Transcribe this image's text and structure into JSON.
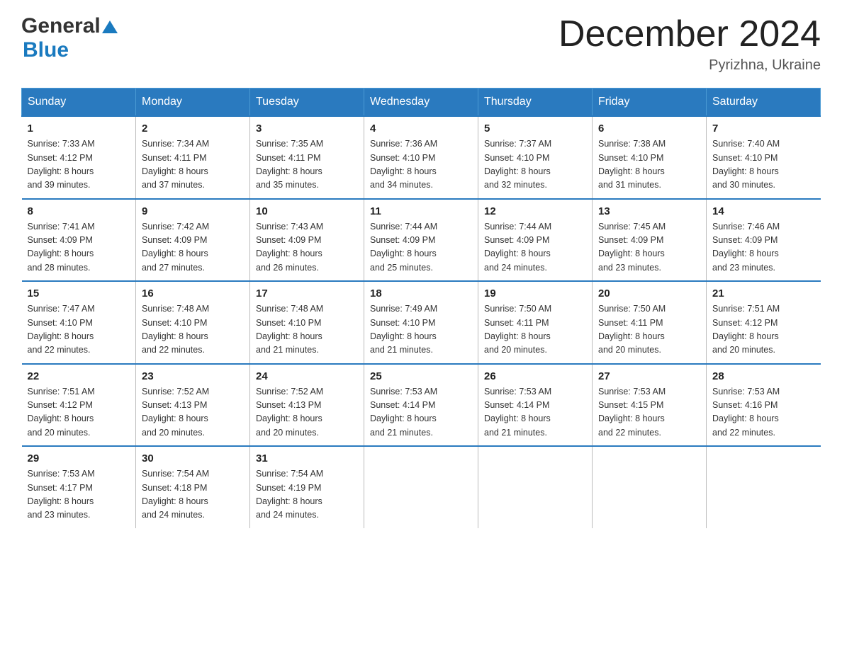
{
  "header": {
    "logo_general": "General",
    "logo_blue": "Blue",
    "month_title": "December 2024",
    "location": "Pyrizhna, Ukraine"
  },
  "days_of_week": [
    "Sunday",
    "Monday",
    "Tuesday",
    "Wednesday",
    "Thursday",
    "Friday",
    "Saturday"
  ],
  "weeks": [
    [
      {
        "day": "1",
        "sunrise": "7:33 AM",
        "sunset": "4:12 PM",
        "daylight": "8 hours and 39 minutes."
      },
      {
        "day": "2",
        "sunrise": "7:34 AM",
        "sunset": "4:11 PM",
        "daylight": "8 hours and 37 minutes."
      },
      {
        "day": "3",
        "sunrise": "7:35 AM",
        "sunset": "4:11 PM",
        "daylight": "8 hours and 35 minutes."
      },
      {
        "day": "4",
        "sunrise": "7:36 AM",
        "sunset": "4:10 PM",
        "daylight": "8 hours and 34 minutes."
      },
      {
        "day": "5",
        "sunrise": "7:37 AM",
        "sunset": "4:10 PM",
        "daylight": "8 hours and 32 minutes."
      },
      {
        "day": "6",
        "sunrise": "7:38 AM",
        "sunset": "4:10 PM",
        "daylight": "8 hours and 31 minutes."
      },
      {
        "day": "7",
        "sunrise": "7:40 AM",
        "sunset": "4:10 PM",
        "daylight": "8 hours and 30 minutes."
      }
    ],
    [
      {
        "day": "8",
        "sunrise": "7:41 AM",
        "sunset": "4:09 PM",
        "daylight": "8 hours and 28 minutes."
      },
      {
        "day": "9",
        "sunrise": "7:42 AM",
        "sunset": "4:09 PM",
        "daylight": "8 hours and 27 minutes."
      },
      {
        "day": "10",
        "sunrise": "7:43 AM",
        "sunset": "4:09 PM",
        "daylight": "8 hours and 26 minutes."
      },
      {
        "day": "11",
        "sunrise": "7:44 AM",
        "sunset": "4:09 PM",
        "daylight": "8 hours and 25 minutes."
      },
      {
        "day": "12",
        "sunrise": "7:44 AM",
        "sunset": "4:09 PM",
        "daylight": "8 hours and 24 minutes."
      },
      {
        "day": "13",
        "sunrise": "7:45 AM",
        "sunset": "4:09 PM",
        "daylight": "8 hours and 23 minutes."
      },
      {
        "day": "14",
        "sunrise": "7:46 AM",
        "sunset": "4:09 PM",
        "daylight": "8 hours and 23 minutes."
      }
    ],
    [
      {
        "day": "15",
        "sunrise": "7:47 AM",
        "sunset": "4:10 PM",
        "daylight": "8 hours and 22 minutes."
      },
      {
        "day": "16",
        "sunrise": "7:48 AM",
        "sunset": "4:10 PM",
        "daylight": "8 hours and 22 minutes."
      },
      {
        "day": "17",
        "sunrise": "7:48 AM",
        "sunset": "4:10 PM",
        "daylight": "8 hours and 21 minutes."
      },
      {
        "day": "18",
        "sunrise": "7:49 AM",
        "sunset": "4:10 PM",
        "daylight": "8 hours and 21 minutes."
      },
      {
        "day": "19",
        "sunrise": "7:50 AM",
        "sunset": "4:11 PM",
        "daylight": "8 hours and 20 minutes."
      },
      {
        "day": "20",
        "sunrise": "7:50 AM",
        "sunset": "4:11 PM",
        "daylight": "8 hours and 20 minutes."
      },
      {
        "day": "21",
        "sunrise": "7:51 AM",
        "sunset": "4:12 PM",
        "daylight": "8 hours and 20 minutes."
      }
    ],
    [
      {
        "day": "22",
        "sunrise": "7:51 AM",
        "sunset": "4:12 PM",
        "daylight": "8 hours and 20 minutes."
      },
      {
        "day": "23",
        "sunrise": "7:52 AM",
        "sunset": "4:13 PM",
        "daylight": "8 hours and 20 minutes."
      },
      {
        "day": "24",
        "sunrise": "7:52 AM",
        "sunset": "4:13 PM",
        "daylight": "8 hours and 20 minutes."
      },
      {
        "day": "25",
        "sunrise": "7:53 AM",
        "sunset": "4:14 PM",
        "daylight": "8 hours and 21 minutes."
      },
      {
        "day": "26",
        "sunrise": "7:53 AM",
        "sunset": "4:14 PM",
        "daylight": "8 hours and 21 minutes."
      },
      {
        "day": "27",
        "sunrise": "7:53 AM",
        "sunset": "4:15 PM",
        "daylight": "8 hours and 22 minutes."
      },
      {
        "day": "28",
        "sunrise": "7:53 AM",
        "sunset": "4:16 PM",
        "daylight": "8 hours and 22 minutes."
      }
    ],
    [
      {
        "day": "29",
        "sunrise": "7:53 AM",
        "sunset": "4:17 PM",
        "daylight": "8 hours and 23 minutes."
      },
      {
        "day": "30",
        "sunrise": "7:54 AM",
        "sunset": "4:18 PM",
        "daylight": "8 hours and 24 minutes."
      },
      {
        "day": "31",
        "sunrise": "7:54 AM",
        "sunset": "4:19 PM",
        "daylight": "8 hours and 24 minutes."
      },
      null,
      null,
      null,
      null
    ]
  ]
}
